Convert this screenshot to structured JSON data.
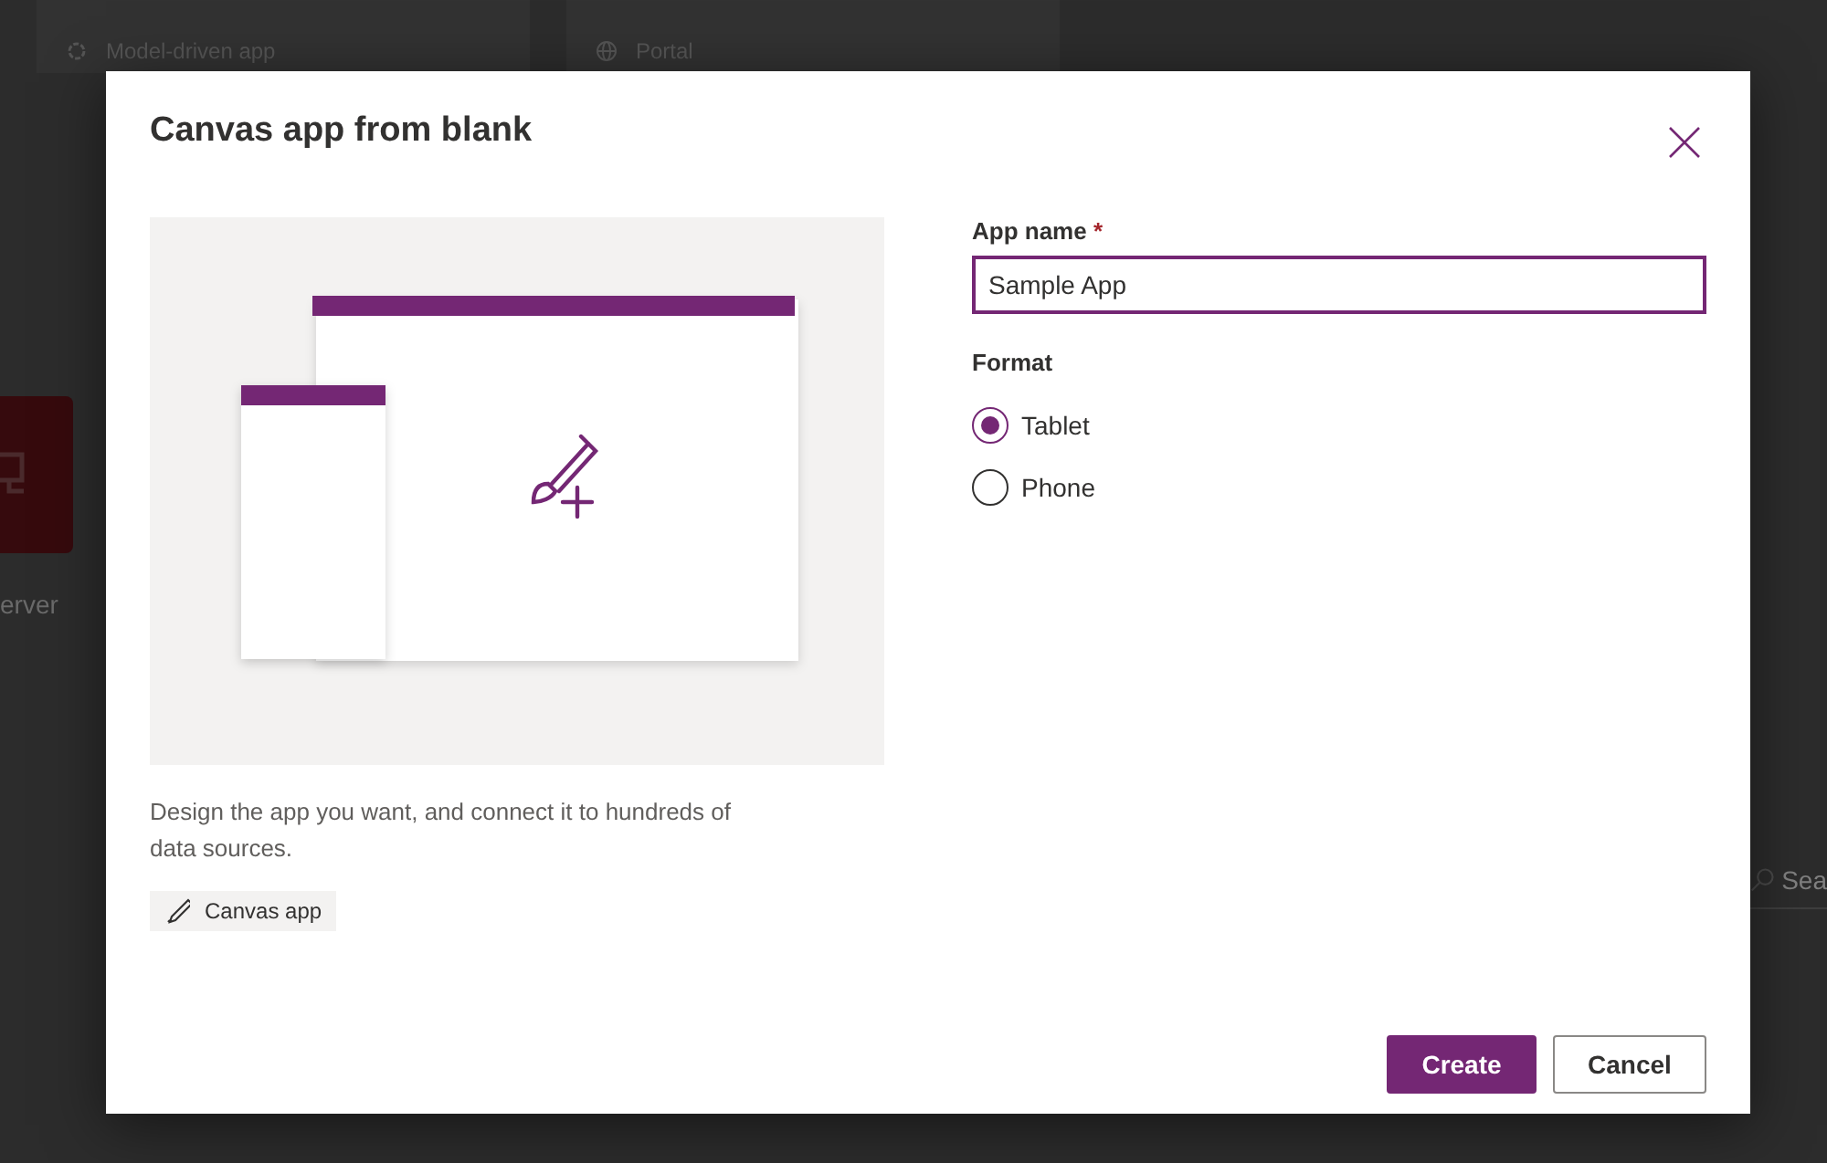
{
  "background": {
    "cards": [
      {
        "subtitle": "Model-driven app",
        "kind": "model"
      },
      {
        "subtitle": "Portal",
        "kind": "portal"
      }
    ],
    "tile_caption": "erver",
    "search": {
      "placeholder": "Sea"
    }
  },
  "dialog": {
    "title": "Canvas app from blank",
    "description": "Design the app you want, and connect it to hundreds of data sources.",
    "tag": "Canvas app",
    "app_name": {
      "label": "App name",
      "required_mark": "*",
      "value": "Sample App"
    },
    "format": {
      "label": "Format",
      "options": [
        {
          "label": "Tablet",
          "selected": true
        },
        {
          "label": "Phone",
          "selected": false
        }
      ]
    },
    "buttons": [
      {
        "label": "Create",
        "kind": "primary"
      },
      {
        "label": "Cancel",
        "kind": "secondary"
      }
    ]
  }
}
